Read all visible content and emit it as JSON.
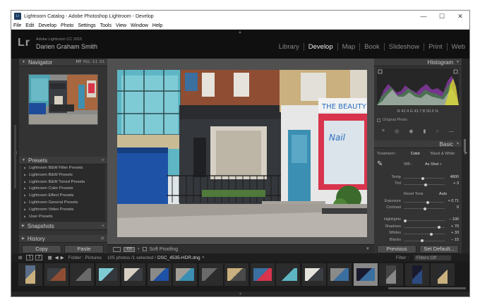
{
  "window": {
    "title": "Lightroom Catalog - Adobe Photoshop Lightroom - Develop",
    "controls": {
      "minimize": "—",
      "maximize": "☐",
      "close": "✕"
    }
  },
  "menu": [
    "File",
    "Edit",
    "Develop",
    "Photo",
    "Settings",
    "Tools",
    "View",
    "Window",
    "Help"
  ],
  "identity": {
    "logo": "Lr",
    "version": "Adobe Lightroom CC 2015",
    "user": "Darien Graham Smith"
  },
  "modules": [
    {
      "label": "Library",
      "active": false
    },
    {
      "label": "Develop",
      "active": true
    },
    {
      "label": "Map",
      "active": false
    },
    {
      "label": "Book",
      "active": false
    },
    {
      "label": "Slideshow",
      "active": false
    },
    {
      "label": "Print",
      "active": false
    },
    {
      "label": "Web",
      "active": false
    }
  ],
  "left": {
    "navigator": {
      "title": "Navigator",
      "opts": [
        "FIT",
        "FILL",
        "1:1",
        "3:1"
      ]
    },
    "presets": {
      "title": "Presets",
      "items": [
        "Lightroom B&W Filter Presets",
        "Lightroom B&W Presets",
        "Lightroom B&W Toned Presets",
        "Lightroom Color Presets",
        "Lightroom Effect Presets",
        "Lightroom General Presets",
        "Lightroom Video Presets",
        "User Presets"
      ]
    },
    "snapshots": "Snapshots",
    "history": "History",
    "copy": "Copy",
    "paste": "Paste"
  },
  "right": {
    "histogram": {
      "title": "Histogram",
      "readout": {
        "r_label": "R",
        "r": "42.4",
        "g_label": "G",
        "g": "43.7",
        "b_label": "B",
        "b": "50.6",
        "unit": "%"
      },
      "original_photo": "Original Photo"
    },
    "basic": {
      "title": "Basic",
      "treatment_label": "Treatment :",
      "treatment_color": "Color",
      "treatment_bw": "Black & White",
      "wb_label": "WB :",
      "wb_value": "As Shot ÷",
      "sliders_wb": [
        {
          "label": "Temp",
          "value": "4800",
          "pos": 0.45
        },
        {
          "label": "Tint",
          "value": "+ 3",
          "pos": 0.52
        }
      ],
      "tone_label": "Reset Tone",
      "tone_auto": "Auto",
      "sliders_tone": [
        {
          "label": "Exposure",
          "value": "+ 0.71",
          "pos": 0.57
        },
        {
          "label": "Contrast",
          "value": "0",
          "pos": 0.5
        }
      ],
      "sliders_presence": [
        {
          "label": "Highlights",
          "value": "− 100",
          "pos": 0.0
        },
        {
          "label": "Shadows",
          "value": "+ 70",
          "pos": 0.85
        },
        {
          "label": "Whites",
          "value": "+ 33",
          "pos": 0.66
        },
        {
          "label": "Blacks",
          "value": "− 15",
          "pos": 0.43
        }
      ]
    },
    "previous": "Previous",
    "set_default": "Set Default..."
  },
  "toolbar": {
    "soft_proofing": "Soft Proofing",
    "yy": "Y|Y"
  },
  "filmstrip": {
    "page1": "1",
    "page2": "2",
    "source": "Folder : Pictures",
    "count": "105 photos /1 selected /",
    "filename": "DSC_4535-HDR.dng",
    "filter_label": "Filter :",
    "filter_value": "Filters Off"
  },
  "colors": {
    "accent": "#5a8fd0",
    "panel": "#333333",
    "bg": "#262626"
  }
}
